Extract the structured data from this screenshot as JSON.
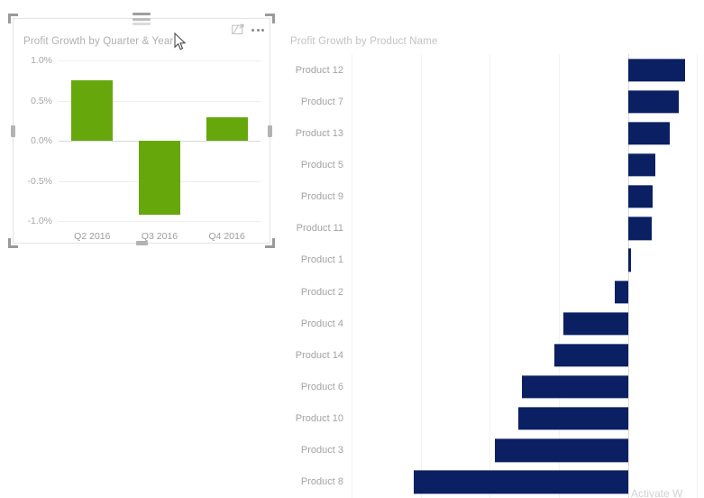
{
  "left_visual": {
    "title": "Profit Growth by Quarter & Year",
    "actions": {
      "drag_handle_name": "drag-handle",
      "focus_mode_label": "Focus mode",
      "more_options_label": "More options"
    },
    "selected": true
  },
  "right_visual": {
    "title": "Profit Growth by Product Name"
  },
  "watermark": "Activate W",
  "colors": {
    "green_bar": "#66a80c",
    "navy_bar": "#0b2062",
    "gridline": "#f2f2f2",
    "zero_line": "#dcdcdc",
    "title_text": "#b0b0b4",
    "tick_text": "#a3a3a7"
  },
  "chart_data": [
    {
      "type": "bar",
      "title": "Profit Growth by Quarter & Year",
      "xlabel": "",
      "ylabel": "",
      "categories": [
        "Q2 2016",
        "Q3 2016",
        "Q4 2016"
      ],
      "values": [
        0.75,
        -0.92,
        0.29
      ],
      "value_unit": "%",
      "ytick_labels": [
        "1.0%",
        "0.5%",
        "0.0%",
        "-0.5%",
        "-1.0%"
      ],
      "ytick_values": [
        1.0,
        0.5,
        0.0,
        -0.5,
        -1.0
      ],
      "ylim": [
        -1.0,
        1.0
      ],
      "grid": "horizontal",
      "legend": "none",
      "series_color": "#66a80c"
    },
    {
      "type": "bar",
      "orientation": "horizontal",
      "title": "Profit Growth by Product Name",
      "xlabel": "",
      "ylabel": "",
      "categories": [
        "Product 12",
        "Product 7",
        "Product 13",
        "Product 5",
        "Product 9",
        "Product 11",
        "Product 1",
        "Product 2",
        "Product 4",
        "Product 14",
        "Product 6",
        "Product 10",
        "Product 3",
        "Product 8"
      ],
      "values": [
        0.82,
        0.74,
        0.6,
        0.39,
        0.36,
        0.35,
        0.05,
        -0.19,
        -0.94,
        -1.07,
        -1.53,
        -1.59,
        -1.92,
        -3.1
      ],
      "value_unit": "%",
      "xtick_labels": [],
      "xlim": [
        -4.0,
        1.1
      ],
      "grid": "vertical",
      "legend": "none",
      "series_color": "#0b2062"
    }
  ]
}
